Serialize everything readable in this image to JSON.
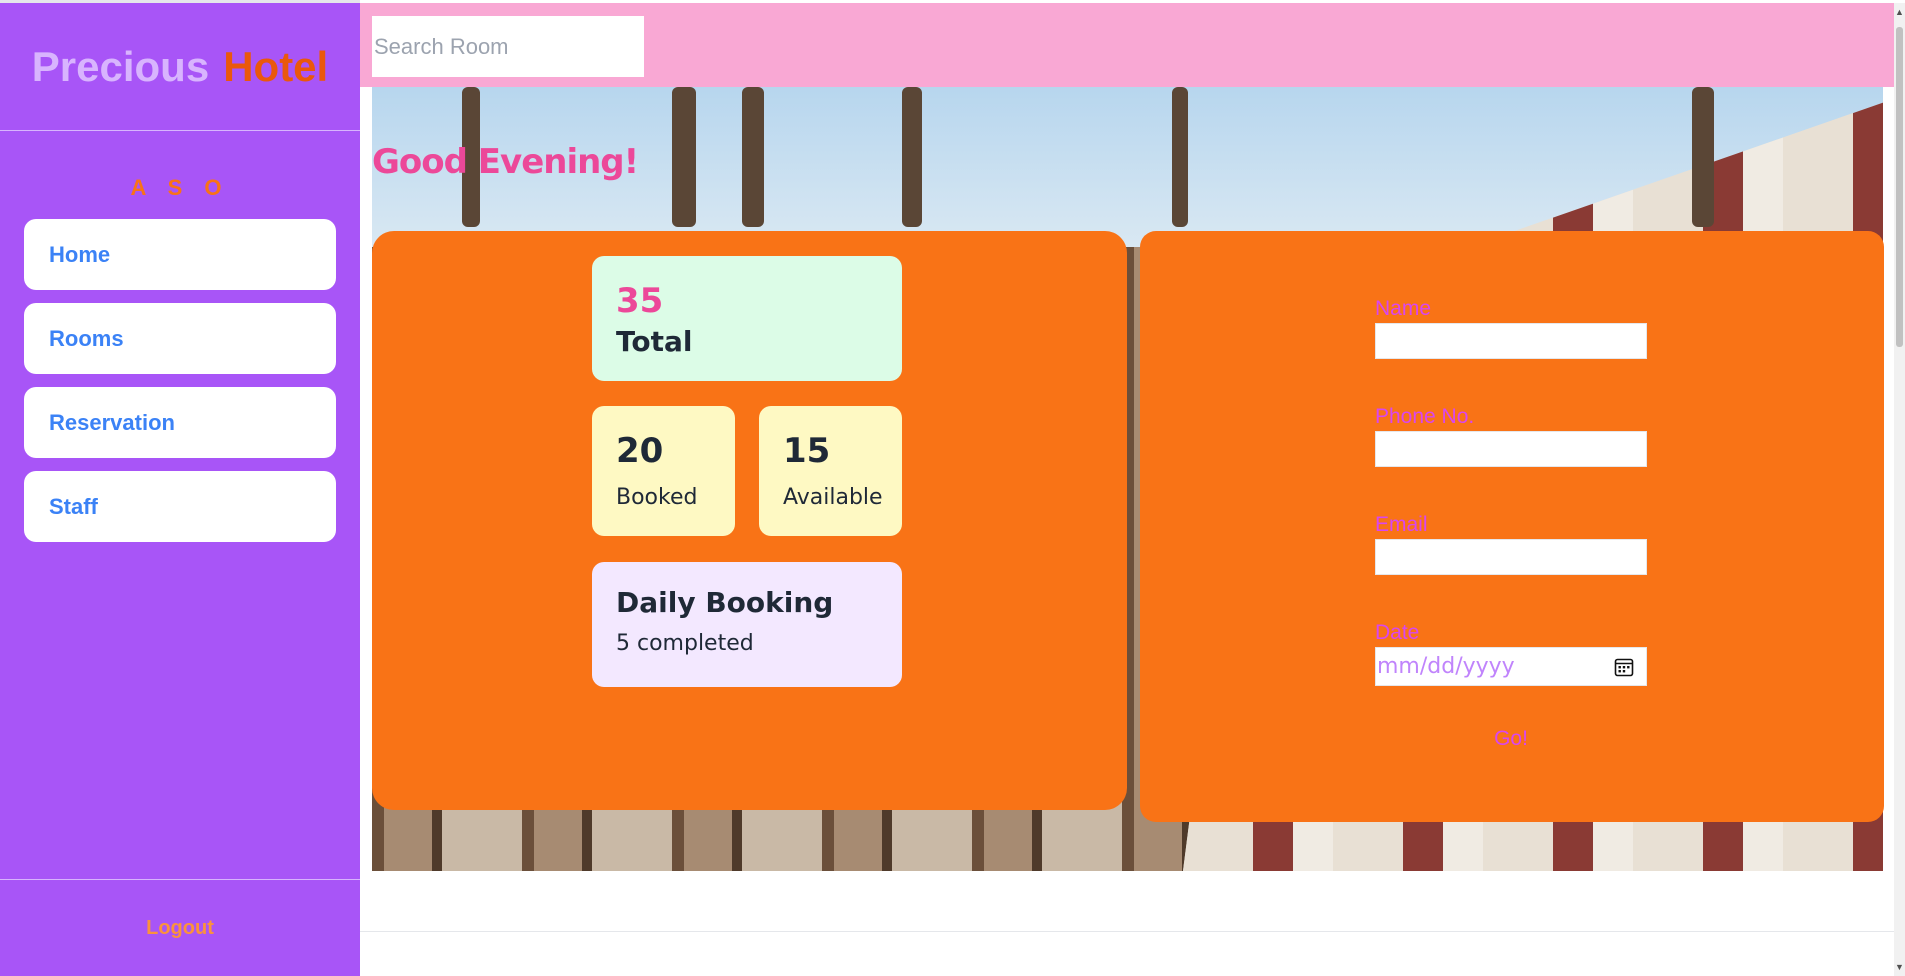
{
  "sidebar": {
    "brand_part1": "Precious",
    "brand_part2": "Hotel",
    "user_initials": "A S O",
    "nav": [
      "Home",
      "Rooms",
      "Reservation",
      "Staff"
    ],
    "logout": "Logout"
  },
  "topbar": {
    "search_placeholder": "Search Room"
  },
  "main": {
    "greeting": "Good Evening!",
    "stats": {
      "total_value": "35",
      "total_label": "Total",
      "booked_value": "20",
      "booked_label": "Booked",
      "available_value": "15",
      "available_label": "Available",
      "daily_title": "Daily Booking",
      "daily_sub": "5 completed"
    },
    "form": {
      "name_label": "Name",
      "phone_label": "Phone No.",
      "email_label": "Email",
      "date_label": "Date",
      "date_placeholder": "mm/dd/yyyy",
      "submit": "Go!"
    }
  },
  "colors": {
    "sidebar_bg": "#a855f7",
    "topbar_bg": "#f9a8d4",
    "panel_bg": "#f97316",
    "accent_pink": "#ec4899",
    "nav_text": "#3b82f6"
  },
  "icons": {
    "date_picker": "calendar-icon"
  }
}
